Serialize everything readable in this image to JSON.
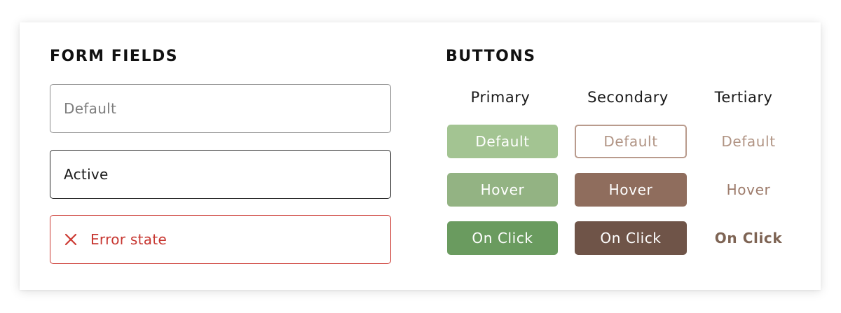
{
  "form_fields": {
    "title": "FORM FIELDS",
    "default_text": "Default",
    "active_text": "Active",
    "error_text": "Error state",
    "error_icon": "close-x-icon"
  },
  "buttons": {
    "title": "BUTTONS",
    "columns": {
      "primary": "Primary",
      "secondary": "Secondary",
      "tertiary": "Tertiary"
    },
    "states": {
      "default": "Default",
      "hover": "Hover",
      "click": "On Click"
    }
  },
  "colors": {
    "primary_default": "#a3c492",
    "primary_hover": "#93b383",
    "primary_click": "#6a9b5f",
    "secondary_border": "#b99b8d",
    "secondary_hover": "#8f6d5d",
    "secondary_click": "#6f5448",
    "tertiary_text": "#b09383",
    "tertiary_click": "#7e6454",
    "error": "#cc3a33"
  }
}
